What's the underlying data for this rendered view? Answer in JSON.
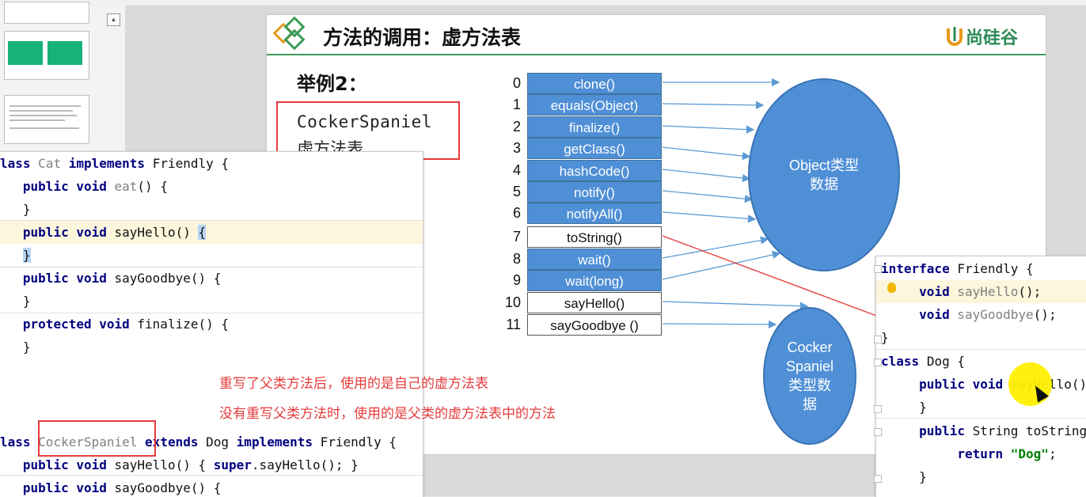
{
  "slide": {
    "title": "方法的调用：虚方法表",
    "brand": "尚硅谷",
    "example_label": "举例2：",
    "vtable_label_line1": "CockerSpaniel",
    "vtable_label_line2": "虚方法表"
  },
  "vtable": {
    "rows": [
      {
        "index": "0",
        "method": "clone()",
        "style": "blue"
      },
      {
        "index": "1",
        "method": "equals(Object)",
        "style": "blue"
      },
      {
        "index": "2",
        "method": "finalize()",
        "style": "blue"
      },
      {
        "index": "3",
        "method": "getClass()",
        "style": "blue"
      },
      {
        "index": "4",
        "method": "hashCode()",
        "style": "blue"
      },
      {
        "index": "5",
        "method": "notify()",
        "style": "blue"
      },
      {
        "index": "6",
        "method": "notifyAll()",
        "style": "blue"
      },
      {
        "index": "7",
        "method": "toString()",
        "style": "white"
      },
      {
        "index": "8",
        "method": "wait()",
        "style": "blue"
      },
      {
        "index": "9",
        "method": "wait(long)",
        "style": "blue"
      },
      {
        "index": "10",
        "method": "sayHello()",
        "style": "white"
      },
      {
        "index": "11",
        "method": "sayGoodbye ()",
        "style": "white"
      }
    ],
    "object_ellipse_line1": "Object类型",
    "object_ellipse_line2": "数据",
    "cocker_ellipse_lines": [
      "Cocker",
      "Spaniel",
      "类型数",
      "据"
    ]
  },
  "annotations": {
    "line1": "重写了父类方法后，使用的是自己的虚方法表",
    "line2": "没有重写父类方法时，使用的是父类的虚方法表中的方法"
  },
  "code_left": {
    "cat_class": {
      "kw1": "lass",
      "name": "Cat",
      "kw2": "implements",
      "iface": "Friendly {"
    },
    "eat": {
      "kw": "public void",
      "name": "eat",
      "rest": "() {"
    },
    "brace1": "}",
    "say_hello": {
      "kw": "public void",
      "rest": "sayHello() ",
      "caret": "{"
    },
    "brace2": "}",
    "say_goodbye": {
      "kw": "public void",
      "rest": "sayGoodbye() {"
    },
    "brace3": "}",
    "finalize": {
      "kw": "protected void",
      "rest": "finalize() {"
    },
    "brace4": "}",
    "cocker_class": {
      "kw1": "lass",
      "name": "CockerSpaniel",
      "kw2": "extends",
      "parent": "Dog",
      "kw3": "implements",
      "iface": "Friendly {"
    },
    "cs_say_hello": {
      "kw": "public void",
      "rest": "sayHello() { ",
      "kw_super": "super",
      "call": ".sayHello(); }"
    },
    "cs_say_goodbye": {
      "kw": "public void",
      "rest": "sayGoodbye() {"
    }
  },
  "code_right": {
    "iface_decl": {
      "kw": "interface",
      "rest": "Friendly {"
    },
    "m1": {
      "kw": "void",
      "name": "sayHello",
      "rest": "();"
    },
    "m2": {
      "kw": "void",
      "name": "sayGoodbye",
      "rest": "();"
    },
    "brace1": "}",
    "dog_decl": {
      "kw": "class",
      "rest": "Dog {"
    },
    "dog_hello": {
      "kw": "public void",
      "rest": "sayHello()"
    },
    "brace2": "}",
    "dog_tostring": {
      "kw": "public",
      "rest": "String toString"
    },
    "ret": {
      "kw": "return",
      "str": "\"Dog\"",
      "end": ";"
    },
    "brace3": "}"
  },
  "colors": {
    "accent_green": "#3a9b57",
    "table_blue": "#4f8fd6",
    "annotation_red": "#e53a3a"
  }
}
